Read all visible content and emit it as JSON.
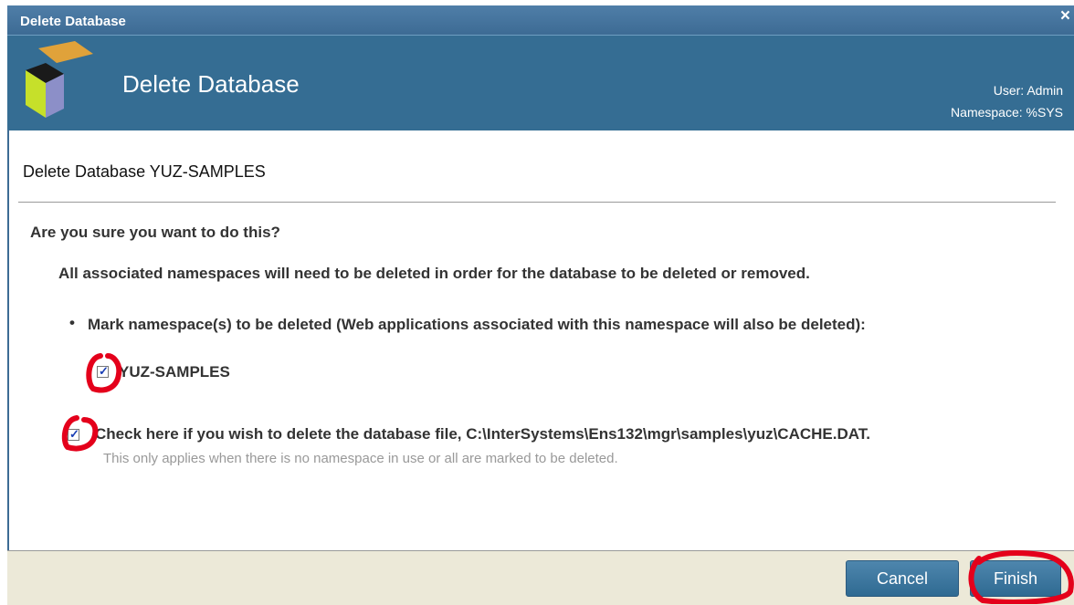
{
  "window": {
    "title": "Delete Database",
    "close_glyph": "×"
  },
  "header": {
    "title": "Delete Database",
    "user": "User: Admin",
    "namespace": "Namespace: %SYS",
    "logo": "cube-logo-icon"
  },
  "dialog": {
    "subtitle": "Delete Database YUZ-SAMPLES",
    "question": "Are you sure you want to do this?",
    "note": "All associated namespaces will need to be deleted in order for the database to be deleted or removed.",
    "bullet": "•",
    "mark_label": "Mark namespace(s) to be deleted (Web applications associated with this namespace will also be deleted):",
    "namespaces": [
      {
        "name": "YUZ-SAMPLES",
        "checked": true
      }
    ],
    "delete_file": {
      "label": "Check here if you wish to delete the database file, C:\\InterSystems\\Ens132\\mgr\\samples\\yuz\\CACHE.DAT.",
      "checked": true,
      "hint": "This only applies when there is no namespace in use or all are marked to be deleted."
    }
  },
  "buttons": {
    "cancel": "Cancel",
    "finish": "Finish"
  },
  "colors": {
    "header": "#356d93",
    "titlebar": "#4f7ea8",
    "button": "#3f78a0",
    "annotation": "#e4001b"
  }
}
